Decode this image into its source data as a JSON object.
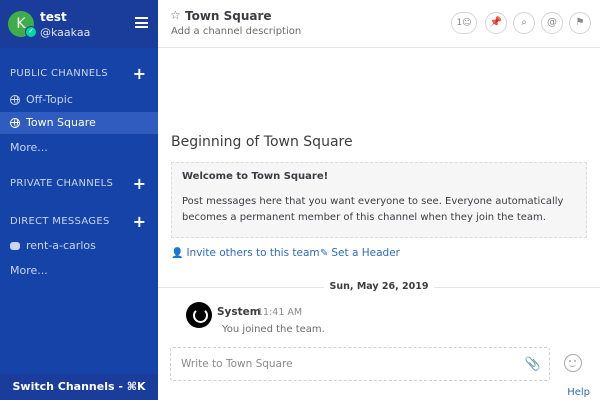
{
  "team": {
    "avatar_letter": "K",
    "name": "test",
    "username": "@kaakaa"
  },
  "sidebar": {
    "public_header": "PUBLIC CHANNELS",
    "public_channels": [
      {
        "label": "Off-Topic"
      },
      {
        "label": "Town Square"
      }
    ],
    "public_more": "More...",
    "private_header": "PRIVATE CHANNELS",
    "direct_header": "DIRECT MESSAGES",
    "direct_messages": [
      {
        "label": "rent-a-carlos"
      }
    ],
    "direct_more": "More...",
    "switch_channels": "Switch Channels - ⌘K"
  },
  "header": {
    "channel_title": "Town Square",
    "channel_description": "Add a channel description",
    "member_count": "1"
  },
  "intro": {
    "title": "Beginning of Town Square",
    "welcome_title": "Welcome to Town Square!",
    "welcome_body": "Post messages here that you want everyone to see. Everyone automatically becomes a permanent member of this channel when they join the team.",
    "invite_link": "Invite others to this team",
    "header_link": "Set a Header"
  },
  "date_separator": "Sun, May 26, 2019",
  "system_post": {
    "author": "System",
    "time": "11:41 AM",
    "message": "You joined the team."
  },
  "composer": {
    "placeholder": "Write to Town Square"
  },
  "footer": {
    "help": "Help"
  },
  "colors": {
    "sidebar_bg": "#1543a8",
    "sidebar_header_bg": "#1a3c9b",
    "active_channel_bg": "#2f5cbe",
    "link": "#2d6cc0",
    "avatar_bg": "#3fae49"
  }
}
